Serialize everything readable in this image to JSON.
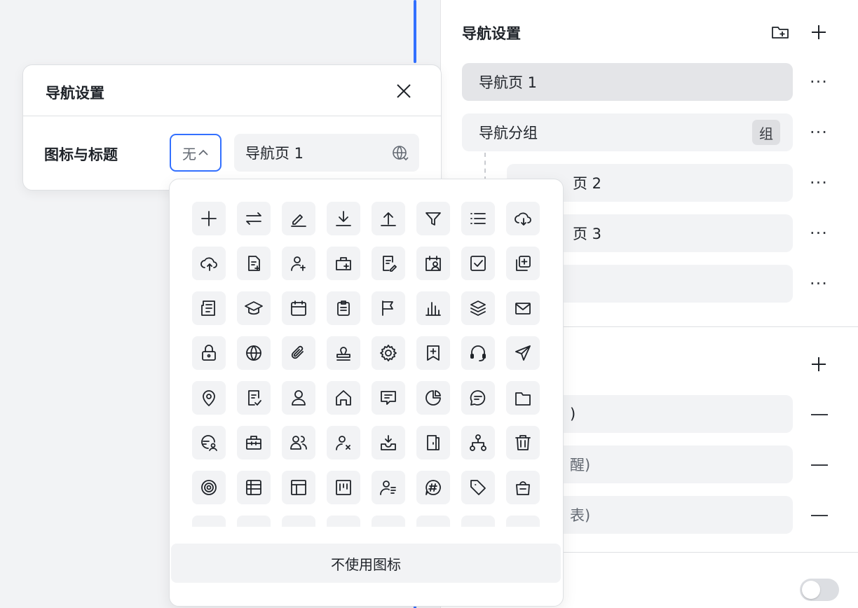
{
  "modal": {
    "title": "导航设置",
    "field_label": "图标与标题",
    "icon_value": "无",
    "title_value": "导航页 1"
  },
  "popover": {
    "no_icon_label": "不使用图标",
    "icons": [
      "plus-icon",
      "swap-icon",
      "edit-icon",
      "download-icon",
      "upload-icon",
      "filter-icon",
      "list-icon",
      "cloud-download-icon",
      "cloud-upload-icon",
      "doc-add-icon",
      "user-add-icon",
      "briefcase-add-icon",
      "doc-edit-icon",
      "calendar-user-icon",
      "checkbox-icon",
      "copy-add-icon",
      "news-icon",
      "graduation-cap-icon",
      "calendar-icon",
      "clipboard-icon",
      "flag-icon",
      "bar-chart-icon",
      "layers-icon",
      "mail-icon",
      "lock-icon",
      "globe-icon",
      "attachment-icon",
      "stamp-icon",
      "gear-icon",
      "bookmark-add-icon",
      "headset-icon",
      "send-icon",
      "location-icon",
      "doc-check-icon",
      "user-icon",
      "home-icon",
      "message-icon",
      "pie-chart-icon",
      "chat-icon",
      "folder-icon",
      "chat-user-icon",
      "toolbox-icon",
      "users-icon",
      "user-remove-icon",
      "inbox-download-icon",
      "door-icon",
      "org-chart-icon",
      "trash-icon",
      "target-icon",
      "table-icon",
      "layout-icon",
      "kanban-icon",
      "user-list-icon",
      "hashtag-chat-icon",
      "tag-icon",
      "shopping-bag-icon"
    ]
  },
  "right_panel": {
    "title": "导航设置",
    "items": [
      {
        "label": "导航页 1"
      },
      {
        "label": "导航分组",
        "tag": "组"
      },
      {
        "label": "导航页 2",
        "partial": "页 2"
      },
      {
        "label": "导航页 3",
        "partial": "页 3"
      },
      {
        "label": ""
      }
    ],
    "section_items": [
      {
        "partial": ")"
      },
      {
        "partial": "醒)"
      },
      {
        "partial": "表)"
      }
    ]
  }
}
